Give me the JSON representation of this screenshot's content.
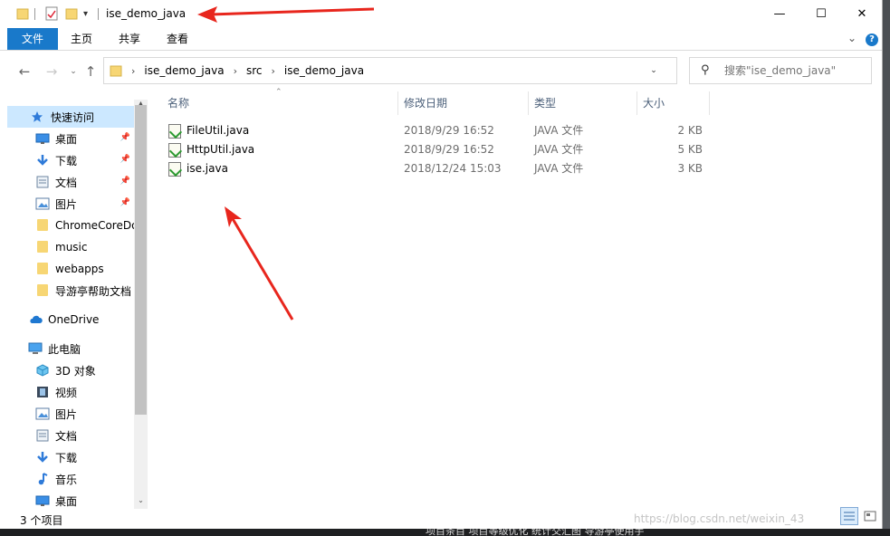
{
  "window": {
    "title": "ise_demo_java",
    "minimize_glyph": "—",
    "maximize_glyph": "☐",
    "close_glyph": "✕"
  },
  "quick_access_toolbar": {
    "icons": [
      "folder-icon",
      "properties-icon",
      "new-folder-icon",
      "customize-dropdown-icon"
    ]
  },
  "ribbon": {
    "tabs": [
      {
        "label": "文件",
        "active": true
      },
      {
        "label": "主页"
      },
      {
        "label": "共享"
      },
      {
        "label": "查看"
      }
    ],
    "collapse_glyph": "⌄",
    "help_glyph": "?"
  },
  "address_bar": {
    "breadcrumbs": [
      "ise_demo_java",
      "src",
      "ise_demo_java"
    ],
    "separator": "›"
  },
  "search": {
    "placeholder": "搜索\"ise_demo_java\""
  },
  "nav_pane": {
    "quick_access": {
      "label": "快速访问",
      "selected": true
    },
    "pinned": [
      {
        "label": "桌面",
        "icon": "desktop-icon",
        "pinned": true
      },
      {
        "label": "下载",
        "icon": "download-icon",
        "pinned": true
      },
      {
        "label": "文档",
        "icon": "documents-icon",
        "pinned": true
      },
      {
        "label": "图片",
        "icon": "pictures-icon",
        "pinned": true
      }
    ],
    "recent_folders": [
      {
        "label": "ChromeCoreDo"
      },
      {
        "label": "music"
      },
      {
        "label": "webapps"
      },
      {
        "label": "导游亭帮助文档"
      }
    ],
    "onedrive": {
      "label": "OneDrive"
    },
    "this_pc": {
      "label": "此电脑"
    },
    "this_pc_items": [
      {
        "label": "3D 对象",
        "icon": "3d-objects-icon"
      },
      {
        "label": "视频",
        "icon": "videos-icon"
      },
      {
        "label": "图片",
        "icon": "pictures-icon"
      },
      {
        "label": "文档",
        "icon": "documents-icon"
      },
      {
        "label": "下载",
        "icon": "download-icon"
      },
      {
        "label": "音乐",
        "icon": "music-icon"
      },
      {
        "label": "桌面",
        "icon": "desktop-icon"
      }
    ]
  },
  "file_list": {
    "columns": [
      "名称",
      "修改日期",
      "类型",
      "大小"
    ],
    "rows": [
      {
        "name": "FileUtil.java",
        "modified": "2018/9/29 16:52",
        "type": "JAVA 文件",
        "size": "2 KB"
      },
      {
        "name": "HttpUtil.java",
        "modified": "2018/9/29 16:52",
        "type": "JAVA 文件",
        "size": "5 KB"
      },
      {
        "name": "ise.java",
        "modified": "2018/12/24 15:03",
        "type": "JAVA 文件",
        "size": "3 KB"
      }
    ]
  },
  "status_bar": {
    "item_count": "3 个项目"
  },
  "watermark": "https://blog.csdn.net/weixin_43",
  "desktop_text": "项目条目 项目等级优化 统计交汇图 导游亭使用手",
  "colors": {
    "accent": "#1979ca",
    "selection": "#cce8ff",
    "annotation_arrow": "#e8261d",
    "folder": "#f7d674"
  }
}
